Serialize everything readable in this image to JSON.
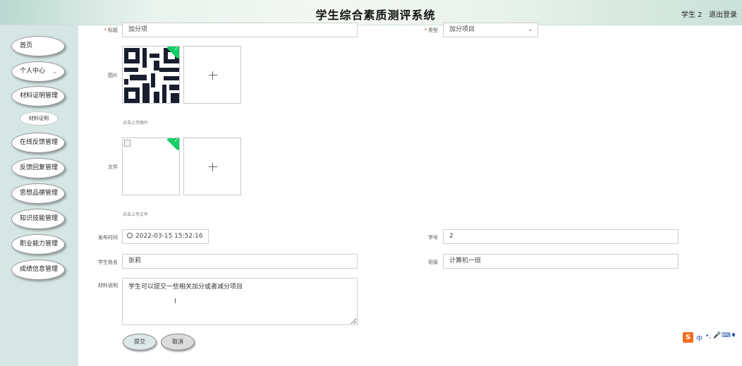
{
  "header": {
    "title": "学生综合素质测评系统",
    "user": "学生 2",
    "logout": "退出登录"
  },
  "sidebar": {
    "items": [
      {
        "label": "首页"
      },
      {
        "label": "个人中心"
      },
      {
        "label": "材料证明管理"
      },
      {
        "label": "材料证明"
      },
      {
        "label": "在线反馈管理"
      },
      {
        "label": "反馈回复管理"
      },
      {
        "label": "思想品德管理"
      },
      {
        "label": "知识技能管理"
      },
      {
        "label": "职业能力管理"
      },
      {
        "label": "成绩信息管理"
      }
    ]
  },
  "form": {
    "title": {
      "label": "标题",
      "value": "加分项"
    },
    "category": {
      "label": "类型",
      "value": "加分项目"
    },
    "image": {
      "label": "图片",
      "hint": "点击上传图片"
    },
    "file": {
      "label": "文件",
      "hint": "点击上传文件"
    },
    "publish_time": {
      "label": "发布时间",
      "value": "2022-03-15 15:52:16"
    },
    "student_id": {
      "label": "学号",
      "value": "2"
    },
    "student_name": {
      "label": "学生姓名",
      "value": "张莉"
    },
    "class": {
      "label": "班级",
      "value": "计算机一班"
    },
    "description": {
      "label": "材料说明",
      "value": "学生可以提交一些相关加分或者减分项目"
    },
    "submit_label": "提交",
    "cancel_label": "取消"
  },
  "ime": {
    "logo": "S",
    "lang": "中"
  },
  "colors": {
    "sidebar_bg": "#d5e6e4",
    "upload_ok": "#13ce66",
    "required": "#e33333"
  }
}
